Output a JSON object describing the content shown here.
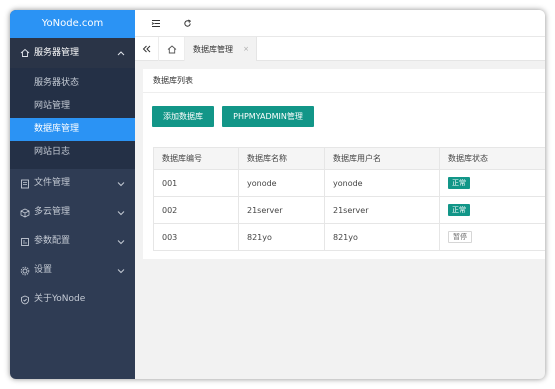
{
  "sidebar": {
    "logo": "YoNode.com",
    "server_menu": {
      "label": "服务器管理",
      "items": [
        "服务器状态",
        "网站管理",
        "数据库管理",
        "网站日志"
      ]
    },
    "menus": [
      {
        "label": "文件管理",
        "icon": "file-icon"
      },
      {
        "label": "多云管理",
        "icon": "cube-icon"
      },
      {
        "label": "参数配置",
        "icon": "config-icon"
      },
      {
        "label": "设置",
        "icon": "gear-icon"
      },
      {
        "label": "关于YoNode",
        "icon": "shield-check-icon"
      }
    ]
  },
  "tabs": {
    "active_label": "数据库管理",
    "close_glyph": "×"
  },
  "card": {
    "title": "数据库列表",
    "add_button": "添加数据库",
    "phpmyadmin_button": "PHPMYADMIN管理"
  },
  "table": {
    "headers": [
      "数据库编号",
      "数据库名称",
      "数据库用户名",
      "数据库状态"
    ],
    "rows": [
      {
        "id": "001",
        "name": "yonode",
        "user": "yonode",
        "status": "正常"
      },
      {
        "id": "002",
        "name": "21server",
        "user": "21server",
        "status": "正常"
      },
      {
        "id": "003",
        "name": "821yo",
        "user": "821yo",
        "status": "暂停"
      }
    ]
  },
  "colors": {
    "accent": "#2b93f4",
    "sidebar": "#2f3c54",
    "button": "#129688"
  }
}
